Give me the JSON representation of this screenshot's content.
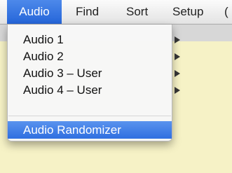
{
  "menubar": {
    "items": [
      {
        "label": "Audio"
      },
      {
        "label": "Find"
      },
      {
        "label": "Sort"
      },
      {
        "label": "Setup"
      },
      {
        "label": "("
      }
    ]
  },
  "audio_menu": {
    "items": [
      {
        "label": "Audio 1",
        "has_submenu": true
      },
      {
        "label": "Audio 2",
        "has_submenu": true
      },
      {
        "label": "Audio 3 – User",
        "has_submenu": true
      },
      {
        "label": "Audio 4 – User",
        "has_submenu": true
      }
    ],
    "randomizer": {
      "label": "Audio Randomizer",
      "highlighted": true
    }
  },
  "colors": {
    "menu_highlight": "#2f6fe0",
    "window_background": "#f6f2c6"
  }
}
